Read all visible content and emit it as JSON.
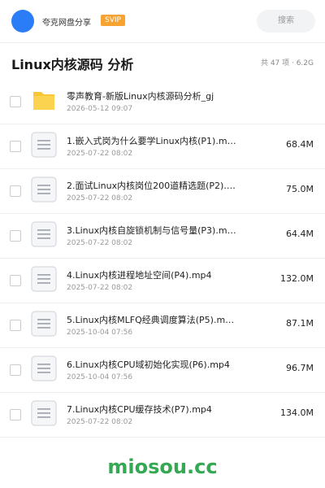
{
  "header": {
    "share_title": "夸克网盘分享",
    "badge": "SVIP",
    "search_placeholder": "搜索"
  },
  "folder": {
    "title": "Linux内核源码 分析",
    "stats": "共 47 项 · 6.2G"
  },
  "files": [
    {
      "name": "零声教育-新版Linux内核源码分析_gj",
      "date": "2026-05-12 09:07",
      "size": "",
      "type": "folder-icon"
    },
    {
      "name": "1.嵌入式岗为什么要学Linux内核(P1).mp4",
      "date": "2025-07-22 08:02",
      "size": "68.4M",
      "type": "video-file-icon"
    },
    {
      "name": "2.面试Linux内核岗位200道精选题(P2).…",
      "date": "2025-07-22 08:02",
      "size": "75.0M",
      "type": "video-file-icon"
    },
    {
      "name": "3.Linux内核自旋锁机制与信号量(P3).mp4",
      "date": "2025-07-22 08:02",
      "size": "64.4M",
      "type": "video-file-icon"
    },
    {
      "name": "4.Linux内核进程地址空间(P4).mp4",
      "date": "2025-07-22 08:02",
      "size": "132.0M",
      "type": "video-file-icon"
    },
    {
      "name": "5.Linux内核MLFQ经典调度算法(P5).m…",
      "date": "2025-10-04 07:56",
      "size": "87.1M",
      "type": "video-file-icon"
    },
    {
      "name": "6.Linux内核CPU域初始化实现(P6).mp4",
      "date": "2025-10-04 07:56",
      "size": "96.7M",
      "type": "video-file-icon"
    },
    {
      "name": "7.Linux内核CPU缓存技术(P7).mp4",
      "date": "2025-07-22 08:02",
      "size": "134.0M",
      "type": "video-file-icon"
    }
  ],
  "watermark": "miosou.cc",
  "colors": {
    "avatar": "#2a7df6",
    "svip_badge": "#f6a331",
    "folder_yellow": "#f9c637",
    "watermark_green": "#35a853"
  }
}
